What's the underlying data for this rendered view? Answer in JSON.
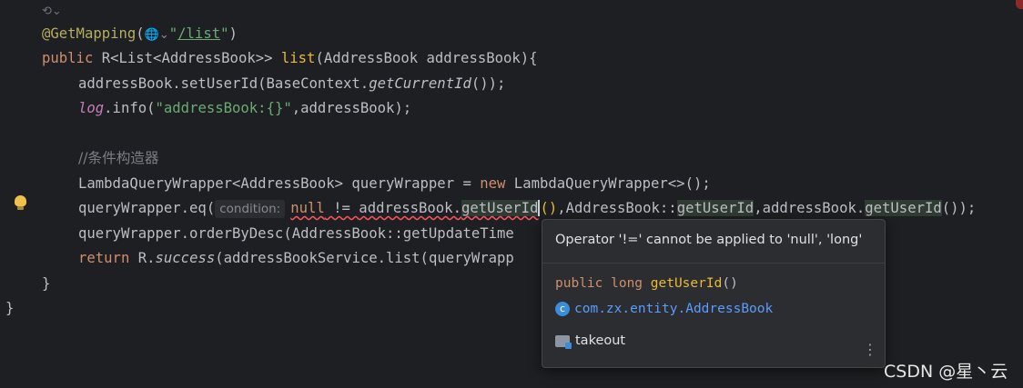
{
  "editor": {
    "line1_annotation": "@GetMapping",
    "line1_paren_open": "(",
    "line1_string_open": "\"",
    "line1_path": "/list",
    "line1_string_close": "\"",
    "line1_paren_close": ")",
    "line2_public": "public",
    "line2_type": " R<List<AddressBook>> ",
    "line2_method": "list",
    "line2_params": "(AddressBook addressBook){",
    "line3_pre": "addressBook.setUserId(BaseContext.",
    "line3_method": "getCurrentId",
    "line3_post": "());",
    "line4_log": "log",
    "line4_mid": ".info(",
    "line4_str": "\"addressBook:{}\"",
    "line4_post": ",addressBook);",
    "line5_comment": "//条件构造器",
    "line6_pre": "LambdaQueryWrapper<AddressBook> queryWrapper = ",
    "line6_new": "new",
    "line6_post": " LambdaQueryWrapper<>();",
    "line7_pre": "queryWrapper.eq(",
    "line7_hint": "condition:",
    "line7_null": "null",
    "line7_op": " != addressBook.",
    "line7_getter": "getUserId",
    "line7_parens": "()",
    "line7_rest1": ",AddressBook::",
    "line7_rest_getter": "getUserId",
    "line7_rest2": ",addressBook.",
    "line7_rest_getter2": "getUserId",
    "line7_rest3": "());",
    "line8_code": "queryWrapper.orderByDesc(AddressBook::getUpdateTime",
    "line9_return": "return",
    "line9_mid": " R.",
    "line9_success": "success",
    "line9_post": "(addressBookService.list(queryWrapp",
    "line10_brace": "}",
    "line11_brace": "}"
  },
  "popup": {
    "error_message": "Operator '!=' cannot be applied to 'null', 'long'",
    "signature_modifiers": "public long ",
    "signature_method": "getUserId",
    "signature_parens": "()",
    "class_icon_letter": "c",
    "class_name": "com.zx.entity.AddressBook",
    "module_name": "takeout",
    "more_label": "⋮"
  },
  "watermark": "CSDN @星丶云",
  "colors": {
    "background": "#1e1f22",
    "keyword": "#cf8e6d",
    "annotation": "#b3ae60",
    "method_decl": "#e8ba36",
    "string": "#6aab73",
    "comment": "#7a7e85",
    "error_underline": "#f75464",
    "link": "#5b9cff"
  },
  "icons": [
    "gutter-fold-icon",
    "web-endpoint-icon",
    "bulb-icon",
    "class-icon",
    "module-folder-icon",
    "more-options-icon"
  ]
}
